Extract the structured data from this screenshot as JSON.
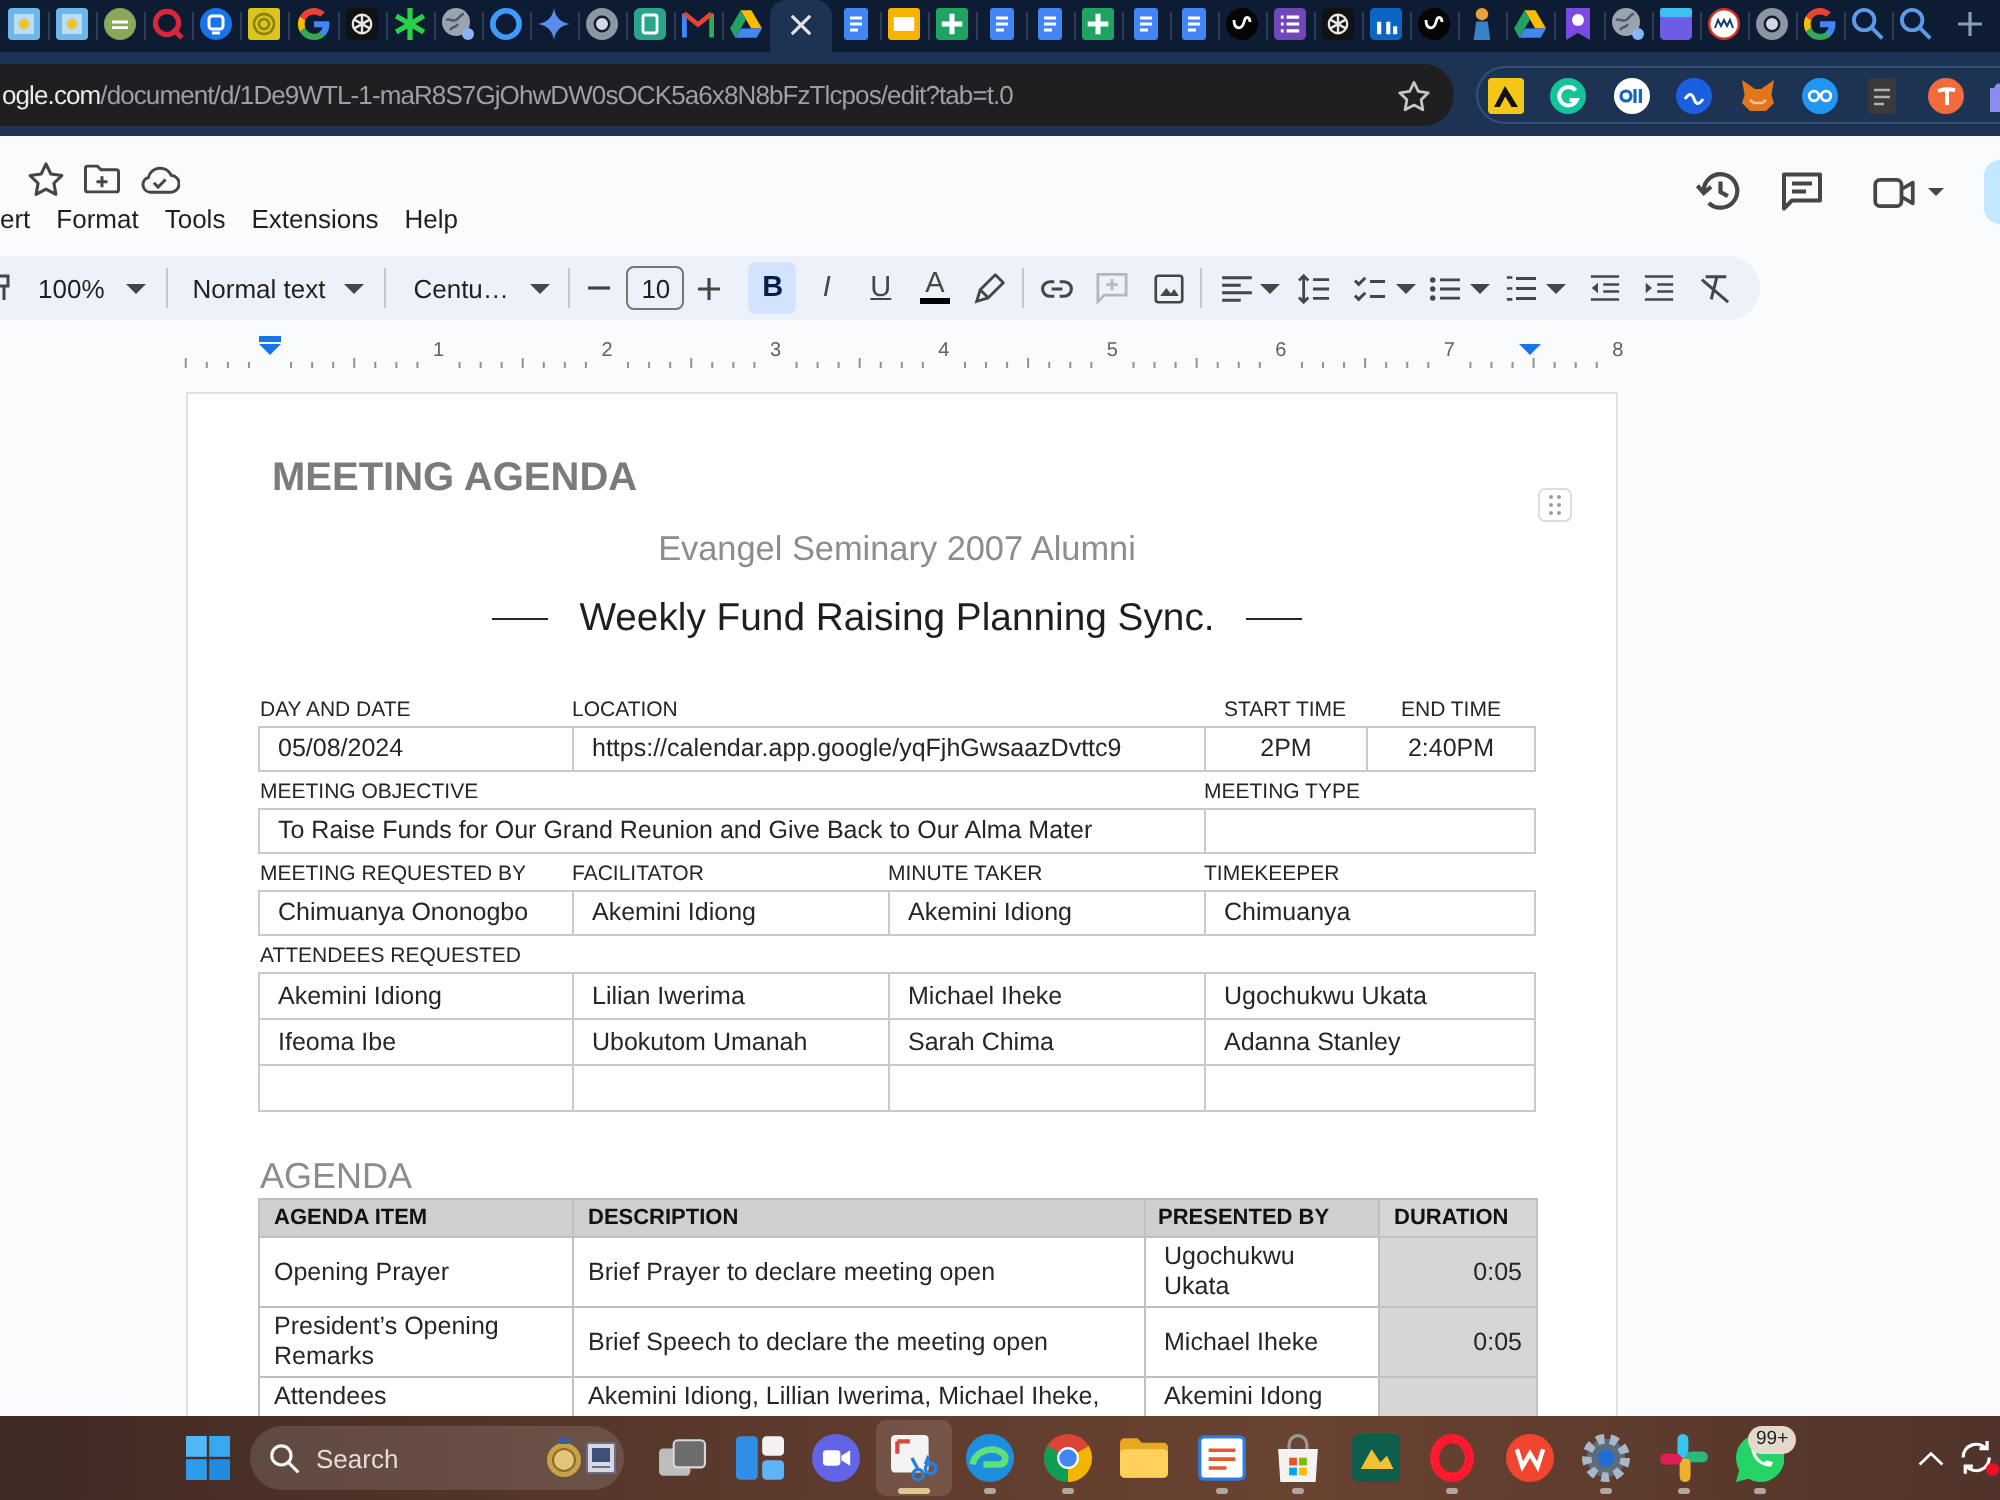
{
  "browser": {
    "tabs": [
      {
        "selected": false
      },
      {
        "selected": false
      },
      {
        "selected": false
      },
      {
        "selected": false
      },
      {
        "selected": false
      },
      {
        "selected": false
      },
      {
        "selected": false
      },
      {
        "selected": false
      },
      {
        "selected": false
      },
      {
        "selected": false
      },
      {
        "selected": false
      },
      {
        "selected": false
      },
      {
        "selected": false
      },
      {
        "selected": false
      },
      {
        "selected": false
      },
      {
        "selected": false
      },
      {
        "selected": true
      },
      {
        "selected": false
      },
      {
        "selected": false
      },
      {
        "selected": false
      },
      {
        "selected": false
      },
      {
        "selected": false
      },
      {
        "selected": false
      },
      {
        "selected": false
      },
      {
        "selected": false
      },
      {
        "selected": false
      },
      {
        "selected": false
      },
      {
        "selected": false
      },
      {
        "selected": false
      },
      {
        "selected": false
      },
      {
        "selected": false
      },
      {
        "selected": false
      },
      {
        "selected": false
      },
      {
        "selected": false
      },
      {
        "selected": false
      },
      {
        "selected": false
      },
      {
        "selected": false
      },
      {
        "selected": false
      },
      {
        "selected": false
      },
      {
        "selected": false
      }
    ],
    "address": {
      "host": "ogle.com",
      "path": "/document/d/1De9WTL-1-maR8S7GjOhwDW0sOCK5a6x8N8bFzTlcpos/edit?tab=t.0"
    }
  },
  "docs": {
    "menu": [
      "ert",
      "Format",
      "Tools",
      "Extensions",
      "Help"
    ],
    "toolbar": {
      "zoom": "100%",
      "style": "Normal text",
      "font": "Centu…",
      "font_size": "10",
      "format": [
        {
          "kind": "bold",
          "label": "B",
          "selected": true
        },
        {
          "kind": "italic",
          "label": "I",
          "selected": false
        },
        {
          "kind": "underline",
          "label": "U",
          "selected": false
        },
        {
          "kind": "text_color",
          "label": "A",
          "selected": false
        }
      ],
      "comment_disabled": true
    },
    "ruler": [
      "1",
      "2",
      "3",
      "4",
      "5",
      "6",
      "7",
      "8"
    ]
  },
  "document": {
    "title": "MEETING AGENDA",
    "subtitle": "Evangel Seminary 2007 Alumni",
    "meeting_name": "Weekly Fund Raising Planning Sync.",
    "details": [
      {
        "kind": "schedule",
        "labels": [
          "DAY AND DATE",
          "LOCATION",
          "START TIME",
          "END TIME"
        ],
        "values": [
          "05/08/2024",
          "https://calendar.app.google/yqFjhGwsaazDvttc9",
          "2PM",
          "2:40PM"
        ]
      },
      {
        "kind": "objective",
        "labels": [
          "MEETING OBJECTIVE",
          "MEETING TYPE"
        ],
        "values": [
          "To Raise Funds for Our Grand Reunion and Give Back to Our Alma Mater"
        ]
      },
      {
        "kind": "roles",
        "labels": [
          "MEETING REQUESTED BY",
          "FACILITATOR",
          "MINUTE TAKER",
          "TIMEKEEPER"
        ],
        "values": [
          "Chimuanya Ononogbo",
          "Akemini Idiong",
          "Akemini Idiong",
          "Chimuanya"
        ]
      },
      {
        "kind": "attendees",
        "labels": [
          "ATTENDEES REQUESTED"
        ],
        "rows": [
          [
            "Akemini Idiong",
            "Lilian Iwerima",
            "Michael Iheke",
            "Ugochukwu Ukata"
          ],
          [
            "Ifeoma Ibe",
            "Ubokutom Umanah",
            "Sarah Chima",
            "Adanna Stanley"
          ]
        ]
      }
    ],
    "agenda": {
      "heading": "AGENDA",
      "columns": [
        "AGENDA ITEM",
        "DESCRIPTION",
        "PRESENTED BY",
        "DURATION"
      ],
      "rows": [
        {
          "item": "Opening Prayer",
          "description": "Brief Prayer to declare meeting open",
          "presenter": "Ugochukwu Ukata",
          "duration": "0:05"
        },
        {
          "item": "President’s Opening Remarks",
          "description": "Brief Speech to declare the meeting open",
          "presenter": "Michael Iheke",
          "duration": "0:05"
        },
        {
          "item": "Attendees",
          "description": "Akemini Idiong, Lillian Iwerima, Michael Iheke,",
          "presenter": "Akemini Idong"
        }
      ]
    }
  },
  "taskbar": {
    "search_placeholder": "Search",
    "apps": [
      {
        "running": false,
        "selected": false
      },
      {
        "running": false,
        "selected": false
      },
      {
        "running": false,
        "selected": false
      },
      {
        "running": true,
        "selected": true
      },
      {
        "running": true,
        "selected": false
      },
      {
        "running": true,
        "selected": false
      },
      {
        "running": false,
        "selected": false
      },
      {
        "running": true,
        "selected": false
      },
      {
        "running": true,
        "selected": false
      },
      {
        "running": false,
        "selected": false
      },
      {
        "running": true,
        "selected": false
      },
      {
        "running": false,
        "selected": false
      },
      {
        "running": true,
        "selected": false
      },
      {
        "running": true,
        "selected": false
      },
      {
        "running": true,
        "selected": false,
        "badge": "99+"
      }
    ]
  }
}
